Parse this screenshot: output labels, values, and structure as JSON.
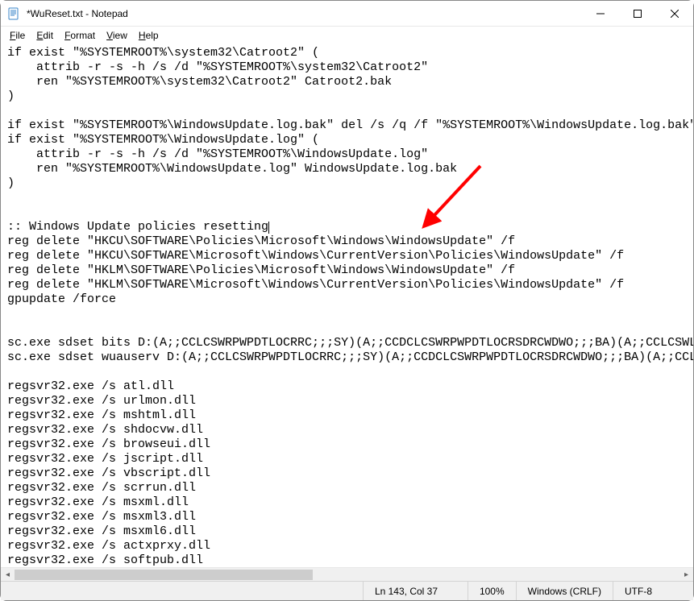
{
  "window": {
    "title": "*WuReset.txt - Notepad"
  },
  "menu": {
    "file": "File",
    "edit": "Edit",
    "format": "Format",
    "view": "View",
    "help": "Help"
  },
  "editor": {
    "lines": [
      "if exist \"%SYSTEMROOT%\\system32\\Catroot2\" (",
      "    attrib -r -s -h /s /d \"%SYSTEMROOT%\\system32\\Catroot2\"",
      "    ren \"%SYSTEMROOT%\\system32\\Catroot2\" Catroot2.bak",
      ")",
      "",
      "if exist \"%SYSTEMROOT%\\WindowsUpdate.log.bak\" del /s /q /f \"%SYSTEMROOT%\\WindowsUpdate.log.bak\"",
      "if exist \"%SYSTEMROOT%\\WindowsUpdate.log\" (",
      "    attrib -r -s -h /s /d \"%SYSTEMROOT%\\WindowsUpdate.log\"",
      "    ren \"%SYSTEMROOT%\\WindowsUpdate.log\" WindowsUpdate.log.bak",
      ")",
      "",
      "",
      ":: Windows Update policies resetting",
      "reg delete \"HKCU\\SOFTWARE\\Policies\\Microsoft\\Windows\\WindowsUpdate\" /f",
      "reg delete \"HKCU\\SOFTWARE\\Microsoft\\Windows\\CurrentVersion\\Policies\\WindowsUpdate\" /f",
      "reg delete \"HKLM\\SOFTWARE\\Policies\\Microsoft\\Windows\\WindowsUpdate\" /f",
      "reg delete \"HKLM\\SOFTWARE\\Microsoft\\Windows\\CurrentVersion\\Policies\\WindowsUpdate\" /f",
      "gpupdate /force",
      "",
      "",
      "sc.exe sdset bits D:(A;;CCLCSWRPWPDTLOCRRC;;;SY)(A;;CCDCLCSWRPWPDTLOCRSDRCWDWO;;;BA)(A;;CCLCSWLOCRRC;;;AU",
      "sc.exe sdset wuauserv D:(A;;CCLCSWRPWPDTLOCRRC;;;SY)(A;;CCDCLCSWRPWPDTLOCRSDRCWDWO;;;BA)(A;;CCLCSWLOCRRC",
      "",
      "regsvr32.exe /s atl.dll",
      "regsvr32.exe /s urlmon.dll",
      "regsvr32.exe /s mshtml.dll",
      "regsvr32.exe /s shdocvw.dll",
      "regsvr32.exe /s browseui.dll",
      "regsvr32.exe /s jscript.dll",
      "regsvr32.exe /s vbscript.dll",
      "regsvr32.exe /s scrrun.dll",
      "regsvr32.exe /s msxml.dll",
      "regsvr32.exe /s msxml3.dll",
      "regsvr32.exe /s msxml6.dll",
      "regsvr32.exe /s actxprxy.dll",
      "regsvr32.exe /s softpub.dll"
    ],
    "caret_line_index": 12
  },
  "status": {
    "position": "Ln 143, Col 37",
    "zoom": "100%",
    "line_ending": "Windows (CRLF)",
    "encoding": "UTF-8"
  },
  "annotation": {
    "arrow_color": "#ff0000"
  }
}
